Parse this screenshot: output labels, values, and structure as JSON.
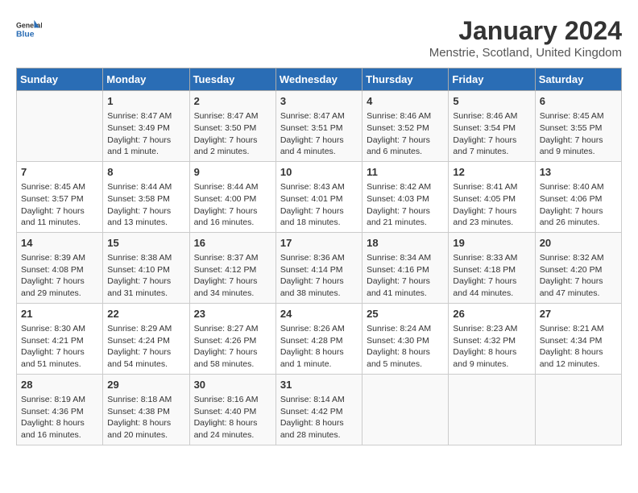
{
  "header": {
    "logo_line1": "General",
    "logo_line2": "Blue",
    "title": "January 2024",
    "subtitle": "Menstrie, Scotland, United Kingdom"
  },
  "days_of_week": [
    "Sunday",
    "Monday",
    "Tuesday",
    "Wednesday",
    "Thursday",
    "Friday",
    "Saturday"
  ],
  "weeks": [
    [
      {
        "day": "",
        "info": ""
      },
      {
        "day": "1",
        "info": "Sunrise: 8:47 AM\nSunset: 3:49 PM\nDaylight: 7 hours\nand 1 minute."
      },
      {
        "day": "2",
        "info": "Sunrise: 8:47 AM\nSunset: 3:50 PM\nDaylight: 7 hours\nand 2 minutes."
      },
      {
        "day": "3",
        "info": "Sunrise: 8:47 AM\nSunset: 3:51 PM\nDaylight: 7 hours\nand 4 minutes."
      },
      {
        "day": "4",
        "info": "Sunrise: 8:46 AM\nSunset: 3:52 PM\nDaylight: 7 hours\nand 6 minutes."
      },
      {
        "day": "5",
        "info": "Sunrise: 8:46 AM\nSunset: 3:54 PM\nDaylight: 7 hours\nand 7 minutes."
      },
      {
        "day": "6",
        "info": "Sunrise: 8:45 AM\nSunset: 3:55 PM\nDaylight: 7 hours\nand 9 minutes."
      }
    ],
    [
      {
        "day": "7",
        "info": "Sunrise: 8:45 AM\nSunset: 3:57 PM\nDaylight: 7 hours\nand 11 minutes."
      },
      {
        "day": "8",
        "info": "Sunrise: 8:44 AM\nSunset: 3:58 PM\nDaylight: 7 hours\nand 13 minutes."
      },
      {
        "day": "9",
        "info": "Sunrise: 8:44 AM\nSunset: 4:00 PM\nDaylight: 7 hours\nand 16 minutes."
      },
      {
        "day": "10",
        "info": "Sunrise: 8:43 AM\nSunset: 4:01 PM\nDaylight: 7 hours\nand 18 minutes."
      },
      {
        "day": "11",
        "info": "Sunrise: 8:42 AM\nSunset: 4:03 PM\nDaylight: 7 hours\nand 21 minutes."
      },
      {
        "day": "12",
        "info": "Sunrise: 8:41 AM\nSunset: 4:05 PM\nDaylight: 7 hours\nand 23 minutes."
      },
      {
        "day": "13",
        "info": "Sunrise: 8:40 AM\nSunset: 4:06 PM\nDaylight: 7 hours\nand 26 minutes."
      }
    ],
    [
      {
        "day": "14",
        "info": "Sunrise: 8:39 AM\nSunset: 4:08 PM\nDaylight: 7 hours\nand 29 minutes."
      },
      {
        "day": "15",
        "info": "Sunrise: 8:38 AM\nSunset: 4:10 PM\nDaylight: 7 hours\nand 31 minutes."
      },
      {
        "day": "16",
        "info": "Sunrise: 8:37 AM\nSunset: 4:12 PM\nDaylight: 7 hours\nand 34 minutes."
      },
      {
        "day": "17",
        "info": "Sunrise: 8:36 AM\nSunset: 4:14 PM\nDaylight: 7 hours\nand 38 minutes."
      },
      {
        "day": "18",
        "info": "Sunrise: 8:34 AM\nSunset: 4:16 PM\nDaylight: 7 hours\nand 41 minutes."
      },
      {
        "day": "19",
        "info": "Sunrise: 8:33 AM\nSunset: 4:18 PM\nDaylight: 7 hours\nand 44 minutes."
      },
      {
        "day": "20",
        "info": "Sunrise: 8:32 AM\nSunset: 4:20 PM\nDaylight: 7 hours\nand 47 minutes."
      }
    ],
    [
      {
        "day": "21",
        "info": "Sunrise: 8:30 AM\nSunset: 4:21 PM\nDaylight: 7 hours\nand 51 minutes."
      },
      {
        "day": "22",
        "info": "Sunrise: 8:29 AM\nSunset: 4:24 PM\nDaylight: 7 hours\nand 54 minutes."
      },
      {
        "day": "23",
        "info": "Sunrise: 8:27 AM\nSunset: 4:26 PM\nDaylight: 7 hours\nand 58 minutes."
      },
      {
        "day": "24",
        "info": "Sunrise: 8:26 AM\nSunset: 4:28 PM\nDaylight: 8 hours\nand 1 minute."
      },
      {
        "day": "25",
        "info": "Sunrise: 8:24 AM\nSunset: 4:30 PM\nDaylight: 8 hours\nand 5 minutes."
      },
      {
        "day": "26",
        "info": "Sunrise: 8:23 AM\nSunset: 4:32 PM\nDaylight: 8 hours\nand 9 minutes."
      },
      {
        "day": "27",
        "info": "Sunrise: 8:21 AM\nSunset: 4:34 PM\nDaylight: 8 hours\nand 12 minutes."
      }
    ],
    [
      {
        "day": "28",
        "info": "Sunrise: 8:19 AM\nSunset: 4:36 PM\nDaylight: 8 hours\nand 16 minutes."
      },
      {
        "day": "29",
        "info": "Sunrise: 8:18 AM\nSunset: 4:38 PM\nDaylight: 8 hours\nand 20 minutes."
      },
      {
        "day": "30",
        "info": "Sunrise: 8:16 AM\nSunset: 4:40 PM\nDaylight: 8 hours\nand 24 minutes."
      },
      {
        "day": "31",
        "info": "Sunrise: 8:14 AM\nSunset: 4:42 PM\nDaylight: 8 hours\nand 28 minutes."
      },
      {
        "day": "",
        "info": ""
      },
      {
        "day": "",
        "info": ""
      },
      {
        "day": "",
        "info": ""
      }
    ]
  ]
}
